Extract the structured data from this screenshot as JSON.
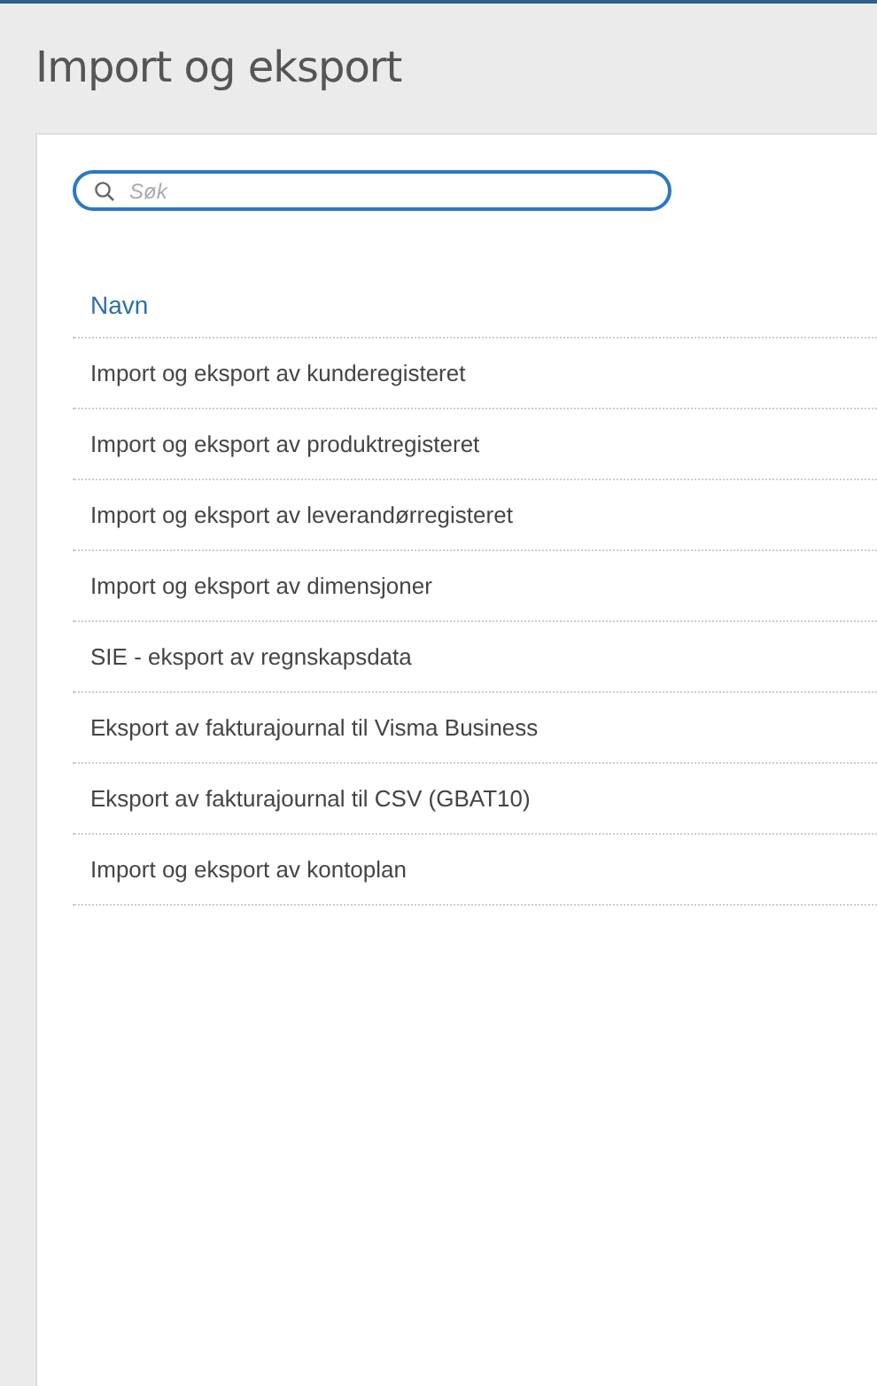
{
  "page": {
    "title": "Import og eksport"
  },
  "search": {
    "placeholder": "Søk"
  },
  "table": {
    "columns": [
      "Navn"
    ],
    "rows": [
      "Import og eksport av kunderegisteret",
      "Import og eksport av produktregisteret",
      "Import og eksport av leverandørregisteret",
      "Import og eksport av dimensjoner",
      "SIE - eksport av regnskapsdata",
      "Eksport av fakturajournal til Visma Business",
      "Eksport av fakturajournal til CSV (GBAT10)",
      "Import og eksport av kontoplan"
    ]
  }
}
